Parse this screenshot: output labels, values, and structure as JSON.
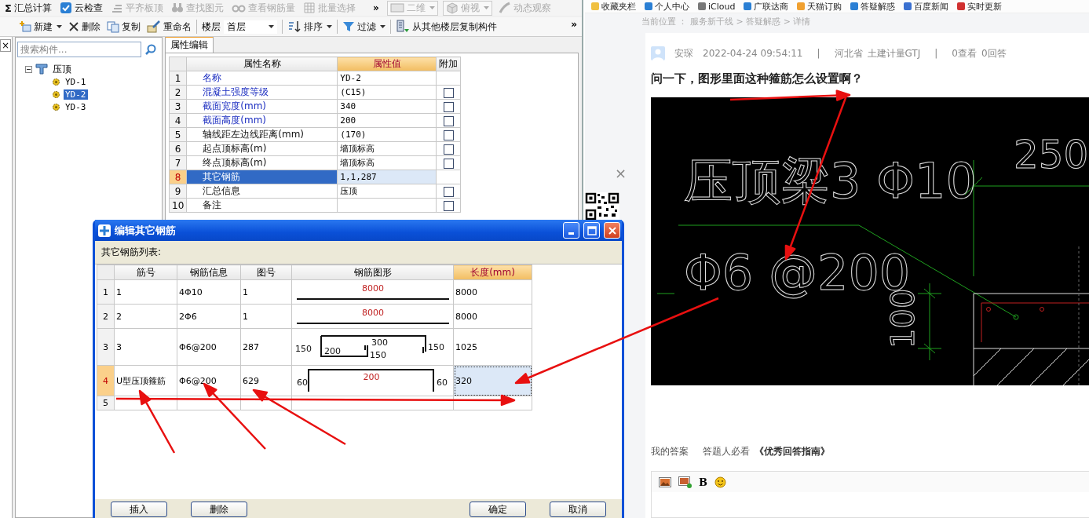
{
  "app": {
    "close_glyph": "×",
    "toolbar": {
      "items": [
        {
          "glyph": "Σ",
          "label": "汇总计算",
          "disabled": false
        },
        {
          "label": "云检查",
          "disabled": false
        },
        {
          "label": "平齐板顶",
          "disabled": true
        },
        {
          "label": "查找图元",
          "disabled": true
        },
        {
          "label": "查看钢筋量",
          "disabled": true
        },
        {
          "label": "批量选择",
          "disabled": true
        }
      ],
      "overflow": "»",
      "view_controls": [
        {
          "label": "二维",
          "disabled": true,
          "dropdown": true
        },
        {
          "label": "俯视",
          "disabled": true,
          "dropdown": true
        },
        {
          "label": "动态观察",
          "disabled": true,
          "dropdown": false
        }
      ]
    },
    "component_bar": {
      "items": [
        {
          "label": "新建",
          "dropdown": true
        },
        {
          "label": "删除",
          "dropdown": false
        },
        {
          "label": "复制",
          "dropdown": false
        },
        {
          "label": "重命名",
          "dropdown": false
        }
      ],
      "floor": {
        "label": "楼层",
        "value": "首层"
      },
      "tools": [
        {
          "label": "排序",
          "dropdown": true
        },
        {
          "label": "过滤",
          "dropdown": true
        },
        {
          "label": "从其他楼层复制构件",
          "dropdown": false
        }
      ],
      "overflow": "»"
    },
    "tree": {
      "search": {
        "placeholder": "搜索构件..."
      },
      "items": [
        {
          "label": "压顶",
          "expanded": true,
          "selected": false,
          "children": [
            {
              "label": "YD-1",
              "selected": false
            },
            {
              "label": "YD-2",
              "selected": true
            },
            {
              "label": "YD-3",
              "selected": false
            }
          ]
        }
      ]
    },
    "properties": {
      "tab": {
        "label": "属性编辑",
        "selected": true
      },
      "columns": [
        {
          "label": "属性名称",
          "highlighted": false
        },
        {
          "label": "属性值",
          "highlighted": true
        },
        {
          "label": "附加",
          "highlighted": false
        }
      ],
      "rows": [
        {
          "num": "1",
          "name": "名称",
          "value": "YD-2",
          "public": true,
          "selected": false
        },
        {
          "num": "2",
          "name": "混凝土强度等级",
          "value": "(C15)",
          "public": true,
          "checked": false,
          "selected": false
        },
        {
          "num": "3",
          "name": "截面宽度(mm)",
          "value": "340",
          "public": true,
          "checked": false,
          "selected": false
        },
        {
          "num": "4",
          "name": "截面高度(mm)",
          "value": "200",
          "public": true,
          "checked": false,
          "selected": false
        },
        {
          "num": "5",
          "name": "轴线距左边线距离(mm)",
          "value": "(170)",
          "public": false,
          "checked": false,
          "selected": false
        },
        {
          "num": "6",
          "name": "起点顶标高(m)",
          "value": "墙顶标高",
          "public": false,
          "checked": false,
          "selected": false
        },
        {
          "num": "7",
          "name": "终点顶标高(m)",
          "value": "墙顶标高",
          "public": false,
          "checked": false,
          "selected": false
        },
        {
          "num": "8",
          "name": "其它钢筋",
          "value": "1,1,287",
          "public": false,
          "selected": true
        },
        {
          "num": "9",
          "name": "汇总信息",
          "value": "压顶",
          "public": false,
          "checked": false,
          "selected": false
        },
        {
          "num": "10",
          "name": "备注",
          "public": false,
          "checked": false,
          "selected": false
        }
      ]
    }
  },
  "dialog": {
    "title": "编辑其它钢筋",
    "list_label": "其它钢筋列表:",
    "columns": [
      {
        "label": "筋号",
        "highlighted": false
      },
      {
        "label": "钢筋信息",
        "highlighted": false
      },
      {
        "label": "图号",
        "highlighted": false
      },
      {
        "label": "钢筋图形",
        "highlighted": false
      },
      {
        "label": "长度(mm)",
        "highlighted": true
      }
    ],
    "rows": [
      {
        "num": "1",
        "bar_no": "1",
        "info": "4Φ10",
        "shape_no": "1",
        "shape": {
          "kind": "straight",
          "labels": [
            "8000"
          ]
        },
        "length": "8000",
        "selected": false
      },
      {
        "num": "2",
        "bar_no": "2",
        "info": "2Φ6",
        "shape_no": "1",
        "shape": {
          "kind": "straight",
          "labels": [
            "8000"
          ]
        },
        "length": "8000",
        "selected": false
      },
      {
        "num": "3",
        "bar_no": "3",
        "info": "Φ6@200",
        "shape_no": "287",
        "shape": {
          "kind": "hooked",
          "labels": [
            "150",
            "200",
            "300",
            "150",
            "150"
          ]
        },
        "length": "1025",
        "selected": false
      },
      {
        "num": "4",
        "bar_no": "U型压顶箍筋",
        "info": "Φ6@200",
        "shape_no": "629",
        "shape": {
          "kind": "u",
          "labels": [
            "60",
            "200",
            "60"
          ]
        },
        "length": "320",
        "selected": true
      },
      {
        "num": "5",
        "selected": false
      }
    ],
    "left_buttons": [
      "插入",
      "删除"
    ],
    "right_buttons": [
      "确定",
      "取消"
    ]
  },
  "browser": {
    "bookmarks": [
      "收藏夹栏",
      "个人中心",
      "iCloud",
      "广联达商",
      "天猫订购",
      "答疑解惑",
      "百度新闻",
      "实时更新"
    ],
    "breadcrumb": "当前位置 ： 服务新干线 > 答疑解惑 > 详情",
    "popup_close": "×",
    "question": {
      "author": "安琛",
      "time": "2022-04-24 09:54:11",
      "separator": "|",
      "region": "河北省",
      "category": "土建计量GTJ",
      "views": "0查看",
      "answers": "0回答",
      "title": "问一下，图形里面这种箍筋怎么设置啊？",
      "drawing": {
        "beam_label": "压顶梁3 Φ10",
        "stirrup_label": "Φ6 @200",
        "width_dim": "250",
        "height_dim": "100"
      }
    },
    "answer_tabs": [
      {
        "label": "我的答案",
        "bold": false
      },
      {
        "label": "答题人必看",
        "bold": false
      },
      {
        "label": "《优秀回答指南》",
        "bold": true
      }
    ],
    "editor": {
      "bold_label": "B"
    }
  }
}
